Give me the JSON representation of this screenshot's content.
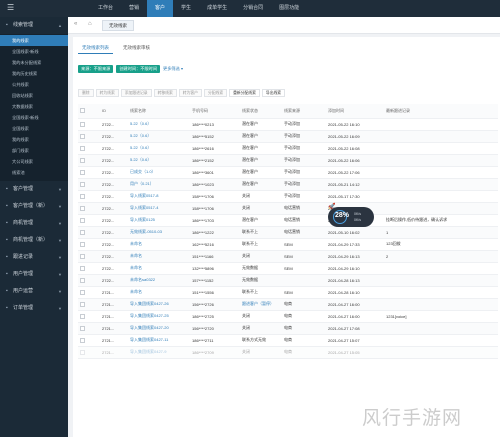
{
  "topbar": {
    "logo": "",
    "nav": [
      {
        "label": "工作台",
        "active": false
      },
      {
        "label": "营销",
        "active": false
      },
      {
        "label": "客户",
        "active": true
      },
      {
        "label": "学生",
        "active": false
      },
      {
        "label": "成单学生",
        "active": false
      },
      {
        "label": "分销合同",
        "active": false
      },
      {
        "label": "图层功能",
        "active": false
      }
    ]
  },
  "sidebar": {
    "groups": [
      {
        "label": "线索管理",
        "expanded": true,
        "items": [
          {
            "label": "我的线索",
            "active": true
          },
          {
            "label": "全国线索-新线",
            "active": false
          },
          {
            "label": "我的未分配线索",
            "active": false
          },
          {
            "label": "我的历史线索",
            "active": false
          },
          {
            "label": "公共线索",
            "active": false
          },
          {
            "label": "回收站线索",
            "active": false
          },
          {
            "label": "大数据线索",
            "active": false
          },
          {
            "label": "全国线索-新线",
            "active": false
          },
          {
            "label": "全国线索",
            "active": false
          },
          {
            "label": "我的线索",
            "active": false
          },
          {
            "label": "部门线索",
            "active": false
          },
          {
            "label": "大公司线索",
            "active": false
          },
          {
            "label": "线索池",
            "active": false
          }
        ]
      },
      {
        "label": "客户管理",
        "expanded": false,
        "items": []
      },
      {
        "label": "客户管理（新）",
        "expanded": false,
        "items": []
      },
      {
        "label": "商机管理",
        "expanded": false,
        "items": []
      },
      {
        "label": "商机管理（新）",
        "expanded": false,
        "items": []
      },
      {
        "label": "跟进记录",
        "expanded": false,
        "items": []
      },
      {
        "label": "用户管理",
        "expanded": false,
        "items": []
      },
      {
        "label": "用户运营",
        "expanded": false,
        "items": []
      },
      {
        "label": "订单管理",
        "expanded": false,
        "items": []
      }
    ]
  },
  "tabbar": {
    "back_icon": "double-chevron-left-icon",
    "home_icon": "home-icon",
    "current_tab": "无效线索"
  },
  "panel": {
    "subtabs": [
      {
        "label": "无效线索列表",
        "active": true
      },
      {
        "label": "无效线索审核",
        "active": false
      }
    ],
    "filters": {
      "tags": [
        "来源：不限来源",
        "创建时间：不限时间"
      ],
      "more_label": "更多筛选 ▾"
    },
    "toolbar": [
      {
        "label": "删除",
        "enabled": false
      },
      {
        "label": "转为线索",
        "enabled": false
      },
      {
        "label": "添加跟进记录",
        "enabled": false
      },
      {
        "label": "转移线索",
        "enabled": false
      },
      {
        "label": "转为客户",
        "enabled": false
      },
      {
        "label": "分配线索",
        "enabled": false
      },
      {
        "label": "重新分配线索",
        "enabled": true
      },
      {
        "label": "导出线索",
        "enabled": true
      }
    ]
  },
  "table": {
    "columns": [
      "ID",
      "线索名称",
      "手机号码",
      "线索状态",
      "线索来源",
      "添加时间",
      "最新跟进记录"
    ],
    "rows": [
      {
        "id": "2722...",
        "name": "5.22（0.6）",
        "phone": "186****0213",
        "status": "潜在客户",
        "source": "手动添加",
        "time": "2021-05-22 16:10",
        "note": "",
        "faded": false
      },
      {
        "id": "2722...",
        "name": "5.22（0.6）",
        "phone": "186****5152",
        "status": "潜在客户",
        "source": "手动添加",
        "time": "2021-05-22 16:09",
        "note": "",
        "faded": false
      },
      {
        "id": "2722...",
        "name": "5.22（0.6）",
        "phone": "186****2616",
        "status": "潜在客户",
        "source": "手动添加",
        "time": "2021-05-22 16:08",
        "note": "",
        "faded": false
      },
      {
        "id": "2722...",
        "name": "5.22（0.6）",
        "phone": "186****2152",
        "status": "潜在客户",
        "source": "手动添加",
        "time": "2021-05-22 16:06",
        "note": "",
        "faded": false
      },
      {
        "id": "2722...",
        "name": "已成交（1.0）",
        "phone": "186****3601",
        "status": "潜在客户",
        "source": "手动添加",
        "time": "2021-05-22 17:06",
        "note": "",
        "faded": false
      },
      {
        "id": "2722...",
        "name": "用户（0.21）",
        "phone": "186****1023",
        "status": "潜在客户",
        "source": "手动添加",
        "time": "2021-05-21 14:12",
        "note": "",
        "faded": false
      },
      {
        "id": "2722...",
        "name": "导入线索0517-8",
        "phone": "158****1706",
        "status": "关闭",
        "source": "手动添加",
        "time": "2021-05-17 17:30",
        "note": "",
        "faded": false
      },
      {
        "id": "2722...",
        "name": "导入线索0517-4",
        "phone": "158****1706",
        "status": "关闭",
        "source": "电话营销",
        "time": "2021-05-17 17:30",
        "note": "",
        "faded": false
      },
      {
        "id": "2722...",
        "name": "导入线索0125",
        "phone": "186****1703",
        "status": "潜在客户",
        "source": "电话营销",
        "time": "2021-05-17 16:59",
        "note": "挂断后操作,低价待跟进，确认诉求",
        "faded": false
      },
      {
        "id": "2722...",
        "name": "无效线索-0510-03",
        "phone": "186****1222",
        "status": "联系不上",
        "source": "电话营销",
        "time": "2021-05-10 16:02",
        "note": "1",
        "faded": false
      },
      {
        "id": "2722...",
        "name": "未命名",
        "phone": "162****5216",
        "status": "联系不上",
        "source": "SEM",
        "time": "2021-04-29 17:33",
        "note": "123回拨",
        "faded": false
      },
      {
        "id": "2722...",
        "name": "未命名",
        "phone": "151****1166",
        "status": "关闭",
        "source": "SEM",
        "time": "2021-04-29 16:13",
        "note": "2",
        "faded": false
      },
      {
        "id": "2722...",
        "name": "未命名",
        "phone": "132****5896",
        "status": "无效数据",
        "source": "SEM",
        "time": "2021-04-29 16:10",
        "note": "",
        "faded": false
      },
      {
        "id": "2722...",
        "name": "未命名sa0322",
        "phone": "157****1152",
        "status": "无效数据",
        "source": "",
        "time": "2021-04-28 16:13",
        "note": "",
        "faded": false
      },
      {
        "id": "2721...",
        "name": "未命名",
        "phone": "151****1556",
        "status": "联系不上",
        "source": "SEM",
        "time": "2021-04-28 16:10",
        "note": "",
        "faded": false
      },
      {
        "id": "2721...",
        "name": "导入集团线索0427-26",
        "phone": "156****2726",
        "status": "跟进客户（暂停）",
        "source": "电商",
        "time": "2021-04-27 16:00",
        "note": "",
        "faded": false
      },
      {
        "id": "2721...",
        "name": "导入集团线索0427-25",
        "phone": "186****2725",
        "status": "关闭",
        "source": "电商",
        "time": "2021-04-27 16:00",
        "note": "1231[voice]",
        "faded": false
      },
      {
        "id": "2721...",
        "name": "导入集团线索0427-20",
        "phone": "156****2720",
        "status": "关闭",
        "source": "电商",
        "time": "2021-04-27 17:08",
        "note": "",
        "faded": false
      },
      {
        "id": "2721...",
        "name": "导入集团线索0427-11",
        "phone": "186****2711",
        "status": "联系方式无效",
        "source": "电商",
        "time": "2021-04-27 15:07",
        "note": "",
        "faded": false
      },
      {
        "id": "2721...",
        "name": "导入集团线索0427-9",
        "phone": "186****2709",
        "status": "关闭",
        "source": "电商",
        "time": "2021-04-27 15:05",
        "note": "",
        "faded": true
      }
    ]
  },
  "widget": {
    "percent": "28%",
    "icon": "rocket-icon",
    "stat_up": "0K/s",
    "stat_down": "0K/s"
  },
  "watermark": "风行手游网"
}
